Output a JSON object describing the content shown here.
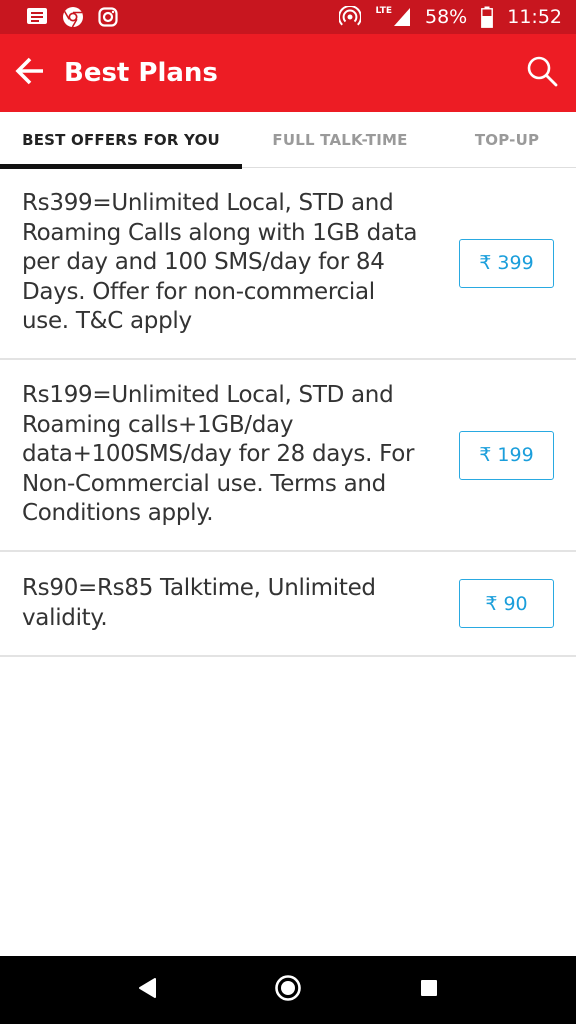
{
  "status_bar": {
    "battery": "58%",
    "time": "11:52",
    "network": "LTE",
    "icons": [
      "message-icon",
      "chrome-icon",
      "instagram-icon",
      "hotspot-icon",
      "signal-icon",
      "battery-icon"
    ]
  },
  "app_bar": {
    "title": "Best Plans",
    "background": "#ed1c24",
    "icons": [
      "back-arrow-icon",
      "search-icon"
    ]
  },
  "tabs": [
    {
      "label": "BEST OFFERS FOR YOU",
      "active": true
    },
    {
      "label": "FULL TALK-TIME",
      "active": false
    },
    {
      "label": "TOP-UP",
      "active": false
    }
  ],
  "plans": [
    {
      "description": "Rs399=Unlimited Local, STD and Roaming Calls along with 1GB data per day and 100 SMS/day for 84 Days. Offer for non-commercial use. T&C apply",
      "price": "₹ 399"
    },
    {
      "description": "Rs199=Unlimited Local, STD and Roaming calls+1GB/day data+100SMS/day for 28 days. For Non-Commercial use. Terms and Conditions apply.",
      "price": "₹ 199"
    },
    {
      "description": "Rs90=Rs85 Talktime, Unlimited validity.",
      "price": "₹ 90"
    }
  ],
  "nav_bar": {
    "icons": [
      "back-triangle-icon",
      "home-circle-icon",
      "recents-square-icon"
    ]
  },
  "colors": {
    "accent": "#ed1c24",
    "status_bar": "#c8161f",
    "price_border": "#29a9e1"
  }
}
